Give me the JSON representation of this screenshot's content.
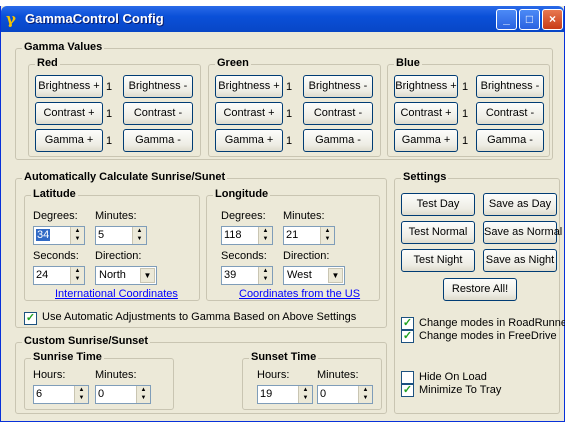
{
  "window": {
    "title": "GammaControl Config",
    "icon": "gamma-icon"
  },
  "gamma": {
    "title": "Gamma Values",
    "red": {
      "label": "Red",
      "b_plus": "Brightness +",
      "b_val": "1",
      "b_minus": "Brightness -",
      "c_plus": "Contrast +",
      "c_val": "1",
      "c_minus": "Contrast -",
      "g_plus": "Gamma +",
      "g_val": "1",
      "g_minus": "Gamma -"
    },
    "green": {
      "label": "Green",
      "b_plus": "Brightness +",
      "b_val": "1",
      "b_minus": "Brightness -",
      "c_plus": "Contrast +",
      "c_val": "1",
      "c_minus": "Contrast -",
      "g_plus": "Gamma +",
      "g_val": "1",
      "g_minus": "Gamma -"
    },
    "blue": {
      "label": "Blue",
      "b_plus": "Brightness +",
      "b_val": "1",
      "b_minus": "Brightness -",
      "c_plus": "Contrast +",
      "c_val": "1",
      "c_minus": "Contrast -",
      "g_plus": "Gamma +",
      "g_val": "1",
      "g_minus": "Gamma -"
    }
  },
  "auto": {
    "title": "Automatically Calculate Sunrise/Sunet",
    "latitude": {
      "label": "Latitude",
      "deg_label": "Degrees:",
      "deg": "34",
      "min_label": "Minutes:",
      "min": "5",
      "sec_label": "Seconds:",
      "sec": "24",
      "dir_label": "Direction:",
      "dir": "North",
      "link": "International Coordinates"
    },
    "longitude": {
      "label": "Longitude",
      "deg_label": "Degrees:",
      "deg": "118",
      "min_label": "Minutes:",
      "min": "21",
      "sec_label": "Seconds:",
      "sec": "39",
      "dir_label": "Direction:",
      "dir": "West",
      "link": "Coordinates from the US"
    },
    "use_auto": "Use Automatic Adjustments to Gamma Based on Above Settings"
  },
  "custom": {
    "title": "Custom Sunrise/Sunset",
    "sunrise": {
      "label": "Sunrise Time",
      "hours_label": "Hours:",
      "hours": "6",
      "min_label": "Minutes:",
      "min": "0"
    },
    "sunset": {
      "label": "Sunset Time",
      "hours_label": "Hours:",
      "hours": "19",
      "min_label": "Minutes:",
      "min": "0"
    }
  },
  "settings": {
    "title": "Settings",
    "test_day": "Test Day",
    "save_day": "Save as Day",
    "test_normal": "Test Normal",
    "save_normal": "Save as Normal",
    "test_night": "Test Night",
    "save_night": "Save as Night",
    "restore": "Restore All!",
    "roadrunner": "Change modes in RoadRunner",
    "freedrive": "Change modes in FreeDrive",
    "hide_on_load": "Hide On Load",
    "minimize": "Minimize To Tray"
  }
}
